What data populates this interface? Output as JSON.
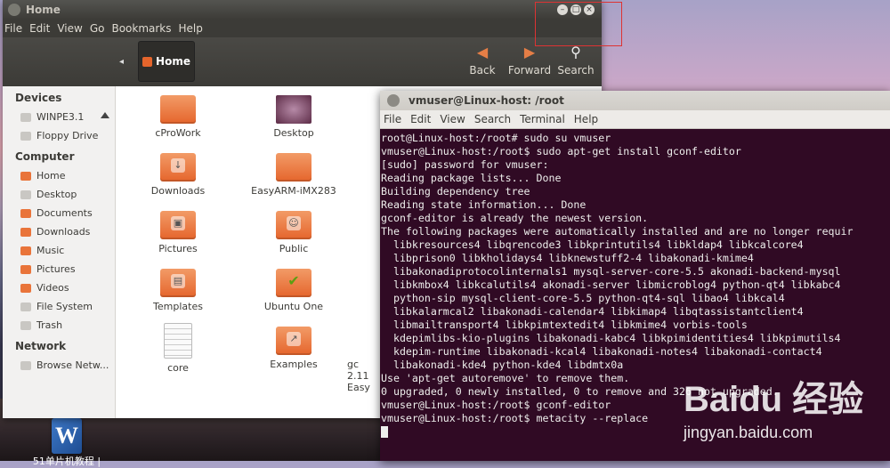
{
  "nautilus": {
    "title": "Home",
    "menu": [
      "File",
      "Edit",
      "View",
      "Go",
      "Bookmarks",
      "Help"
    ],
    "location": "Home",
    "toolbar": {
      "back": "Back",
      "forward": "Forward",
      "search": "Search"
    },
    "sidebar": {
      "sections": [
        {
          "title": "Devices",
          "items": [
            {
              "label": "WINPE3.1",
              "eject": true
            },
            {
              "label": "Floppy Drive"
            }
          ]
        },
        {
          "title": "Computer",
          "items": [
            {
              "label": "Home"
            },
            {
              "label": "Desktop"
            },
            {
              "label": "Documents"
            },
            {
              "label": "Downloads"
            },
            {
              "label": "Music"
            },
            {
              "label": "Pictures"
            },
            {
              "label": "Videos"
            },
            {
              "label": "File System"
            },
            {
              "label": "Trash"
            }
          ]
        },
        {
          "title": "Network",
          "items": [
            {
              "label": "Browse Netw..."
            }
          ]
        }
      ]
    },
    "files": [
      {
        "name": "cProWork",
        "kind": "folder"
      },
      {
        "name": "Desktop",
        "kind": "desktop"
      },
      {
        "name": "Downloads",
        "kind": "folder",
        "badge": "↓"
      },
      {
        "name": "EasyARM-iMX283",
        "kind": "folder"
      },
      {
        "name": "Pictures",
        "kind": "folder",
        "badge": "▣"
      },
      {
        "name": "Public",
        "kind": "folder",
        "badge": "☺"
      },
      {
        "name": "Templates",
        "kind": "folder",
        "badge": "▤"
      },
      {
        "name": "Ubuntu One",
        "kind": "folder",
        "badge": "✔"
      },
      {
        "name": "core",
        "kind": "doc"
      },
      {
        "name": "Examples",
        "kind": "folder",
        "badge": "↗"
      }
    ],
    "partial_labels": [
      "gc",
      "2.11",
      "Easy"
    ]
  },
  "terminal": {
    "title": "vmuser@Linux-host: /root",
    "menu": [
      "File",
      "Edit",
      "View",
      "Search",
      "Terminal",
      "Help"
    ],
    "lines": [
      "root@Linux-host:/root# sudo su vmuser",
      "vmuser@Linux-host:/root$ sudo apt-get install gconf-editor",
      "[sudo] password for vmuser:",
      "Reading package lists... Done",
      "Building dependency tree",
      "Reading state information... Done",
      "gconf-editor is already the newest version.",
      "The following packages were automatically installed and are no longer requir",
      "  libkresources4 libqrencode3 libkprintutils4 libkldap4 libkcalcore4",
      "  libprison0 libkholidays4 libknewstuff2-4 libakonadi-kmime4",
      "  libakonadiprotocolinternals1 mysql-server-core-5.5 akonadi-backend-mysql",
      "  libkmbox4 libkcalutils4 akonadi-server libmicroblog4 python-qt4 libkabc4",
      "  python-sip mysql-client-core-5.5 python-qt4-sql libao4 libkcal4",
      "  libkalarmcal2 libakonadi-calendar4 libkimap4 libqtassistantclient4",
      "  libmailtransport4 libkpimtextedit4 libkmime4 vorbis-tools",
      "  kdepimlibs-kio-plugins libakonadi-kabc4 libkpimidentities4 libkpimutils4",
      "  kdepim-runtime libakonadi-kcal4 libakonadi-notes4 libakonadi-contact4",
      "  libakonadi-kde4 python-kde4 libdmtx0a",
      "Use 'apt-get autoremove' to remove them.",
      "0 upgraded, 0 newly installed, 0 to remove and 326 not upgraded.",
      "vmuser@Linux-host:/root$ gconf-editor",
      "vmuser@Linux-host:/root$ metacity --replace"
    ]
  },
  "desktop": {
    "icon_label": "51单片机教程 |"
  },
  "watermark": {
    "brand": "Baidu 经验",
    "url": "jingyan.baidu.com"
  }
}
